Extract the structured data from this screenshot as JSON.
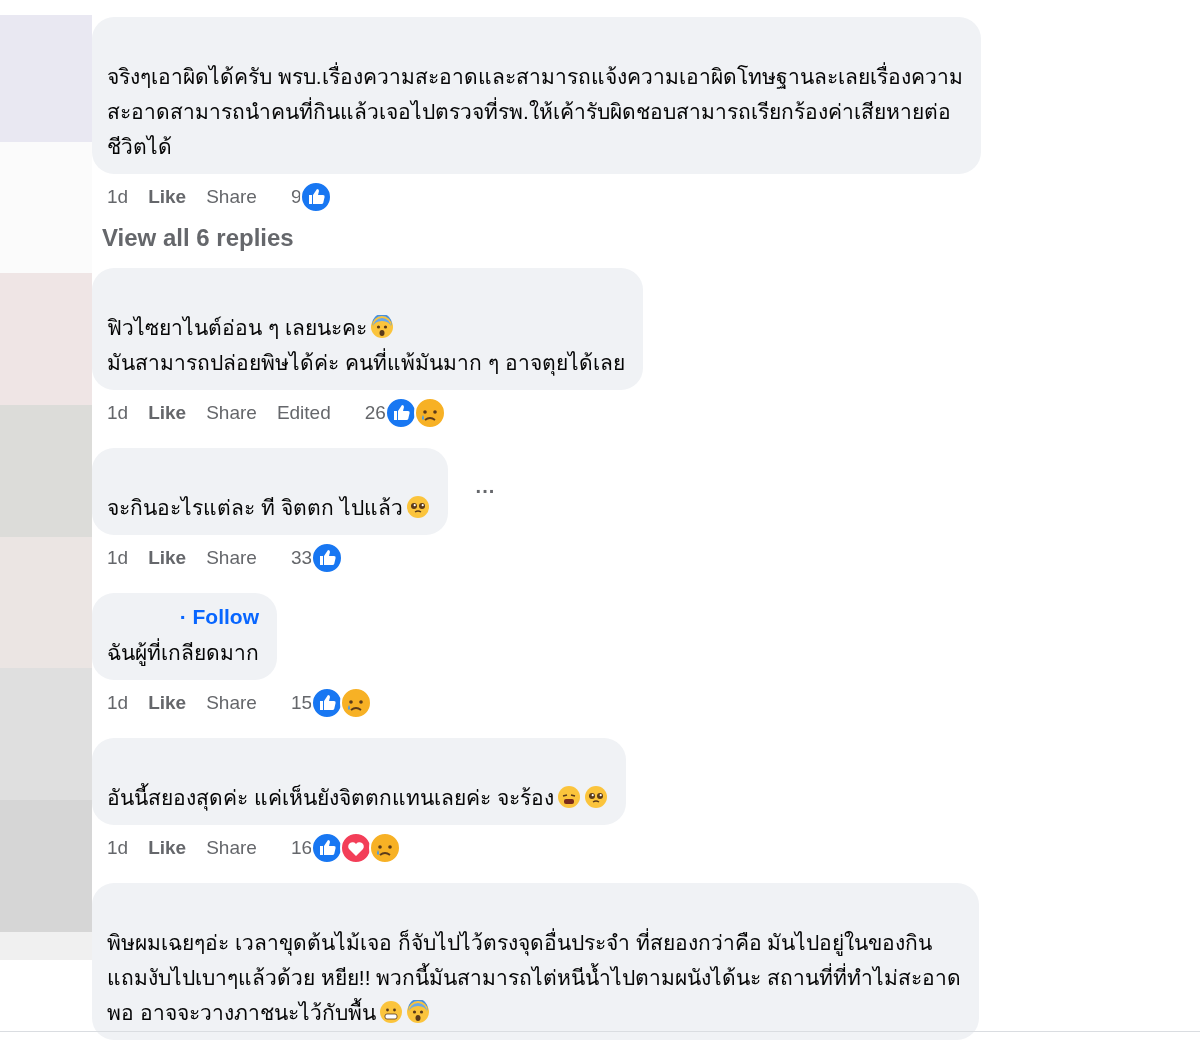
{
  "comments": [
    {
      "lines": [
        {
          "text": "จริงๆเอาผิดได้ครับ พรบ.เรื่องความสะอาดและสามารถแจ้งความเอาผิดโทษฐานละเลยเรื่องความ"
        },
        {
          "text": "สะอาดสามารถนำคนที่กินแล้วเจอไปตรวจที่รพ.ให้เค้ารับผิดชอบสามารถเรียกร้องค่าเสียหายต่อ"
        },
        {
          "text": "ชีวิตได้"
        }
      ],
      "time": "1d",
      "actions": [
        "Like",
        "Share"
      ],
      "count": "9",
      "reactions": [
        {
          "kind": "like"
        }
      ],
      "replies_link": "View all 6 replies"
    },
    {
      "lines": [
        {
          "text": "ฟิวไซยาไนต์อ่อน ๆ เลยนะคะ",
          "emoji": [
            {
              "kind": "scared"
            }
          ]
        },
        {
          "text": "มันสามารถปล่อยพิษได้ค่ะ คนที่แพ้มันมาก ๆ อาจตุยได้เลย"
        }
      ],
      "time": "1d",
      "actions": [
        "Like",
        "Share"
      ],
      "edited": "Edited",
      "count": "26",
      "reactions": [
        {
          "kind": "like"
        },
        {
          "kind": "sad"
        }
      ]
    },
    {
      "lines": [
        {
          "text": "จะกินอะไรแต่ละ ที จิตตก ไปแล้ว",
          "emoji": [
            {
              "kind": "pleading"
            }
          ]
        }
      ],
      "more_button": "···",
      "time": "1d",
      "actions": [
        "Like",
        "Share"
      ],
      "count": "33",
      "reactions": [
        {
          "kind": "like"
        }
      ]
    },
    {
      "lines": [
        {
          "text": "ฉันผู้ที่เกลียดมาก"
        }
      ],
      "follow": "· Follow",
      "time": "1d",
      "actions": [
        "Like",
        "Share"
      ],
      "count": "15",
      "reactions": [
        {
          "kind": "like"
        },
        {
          "kind": "sad"
        }
      ]
    },
    {
      "lines": [
        {
          "text": "อันนี้สยองสุดค่ะ แค่เห็นยังจิตตกแทนเลยค่ะ จะร้อง",
          "emoji": [
            {
              "kind": "tired"
            },
            {
              "kind": "pleading"
            }
          ]
        }
      ],
      "time": "1d",
      "actions": [
        "Like",
        "Share"
      ],
      "count": "16",
      "reactions": [
        {
          "kind": "like"
        },
        {
          "kind": "care"
        },
        {
          "kind": "sad"
        }
      ]
    },
    {
      "lines": [
        {
          "text": "พิษผมเฉยๆอ่ะ เวลาขุดต้นไม้เจอ ก็จับไปไว้ตรงจุดอื่นประจำ ที่สยองกว่าคือ มันไปอยู่ในของกิน"
        },
        {
          "text": "แถมงับไปเบาๆแล้วด้วย หยีย!! พวกนี้มันสามารถไต่หนีน้ำไปตามผนังได้นะ สถานที่ที่ทำไม่สะอาด"
        },
        {
          "text": "พอ อาจจะวางภาชนะไว้กับพื้น",
          "emoji": [
            {
              "kind": "grimace"
            },
            {
              "kind": "scream"
            }
          ]
        }
      ]
    }
  ]
}
